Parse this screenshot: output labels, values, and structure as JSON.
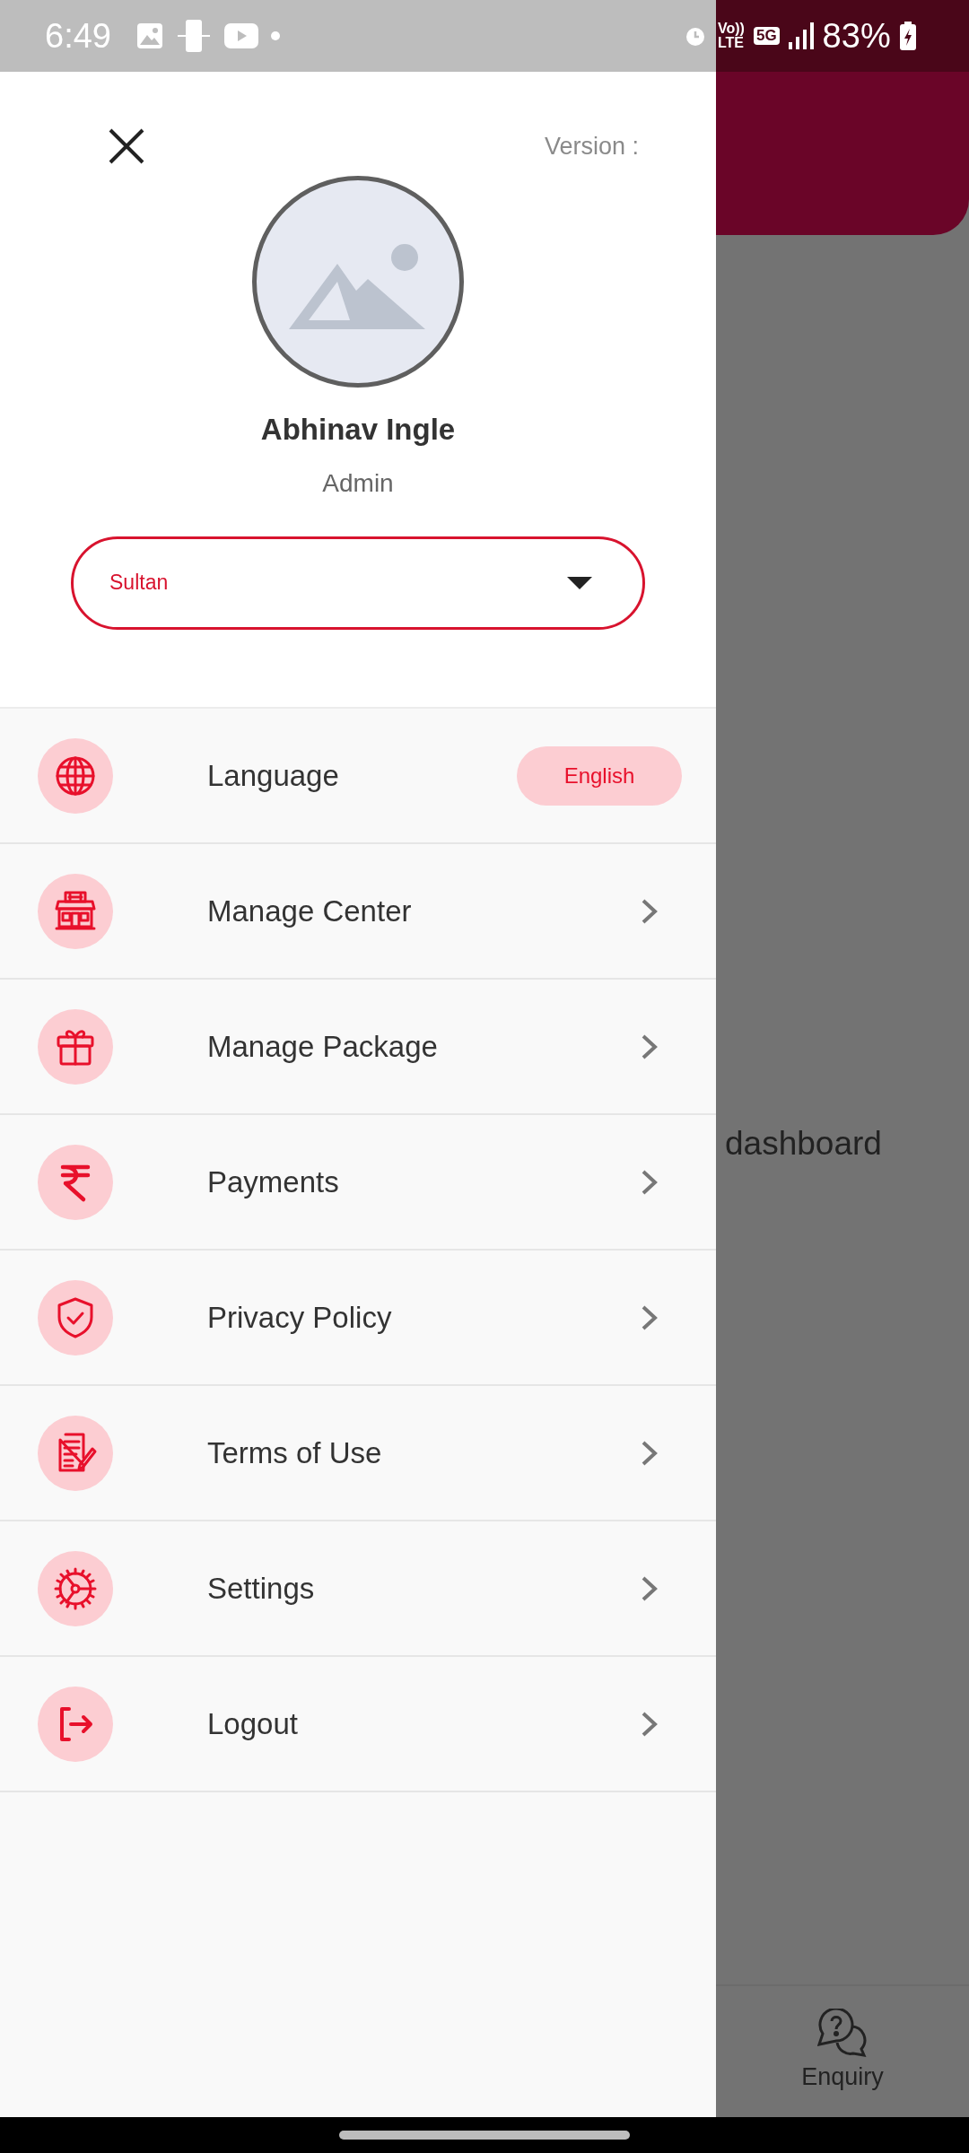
{
  "status_bar": {
    "time": "6:49",
    "volte": [
      "Vo))",
      "LTE"
    ],
    "network": "5G",
    "battery": "83%"
  },
  "drawer": {
    "version_label": "Version :",
    "profile": {
      "name": "Abhinav Ingle",
      "role": "Admin"
    },
    "center_select": {
      "value": "Sultan"
    },
    "menu": [
      {
        "kind": "language",
        "label": "Language",
        "value": "English"
      },
      {
        "kind": "link",
        "label": "Manage Center"
      },
      {
        "kind": "link",
        "label": "Manage Package"
      },
      {
        "kind": "link",
        "label": "Payments"
      },
      {
        "kind": "link",
        "label": "Privacy Policy"
      },
      {
        "kind": "link",
        "label": "Terms of Use"
      },
      {
        "kind": "link",
        "label": "Settings"
      },
      {
        "kind": "link",
        "label": "Logout"
      }
    ]
  },
  "background": {
    "text": "dashboard",
    "bottom_nav": [
      {
        "label": "Enquiry"
      }
    ]
  }
}
